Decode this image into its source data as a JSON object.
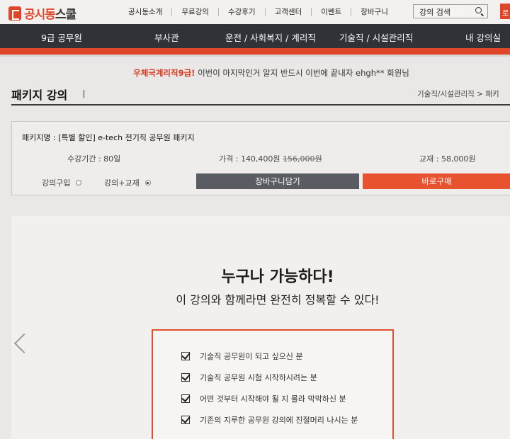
{
  "brand": {
    "name_accent": "공시동",
    "name_rest": "스쿨"
  },
  "top_nav": [
    "공시동소개",
    "무료강의",
    "수강후기",
    "고객센터",
    "이벤트",
    "장바구니"
  ],
  "search": {
    "placeholder": "강의 검색"
  },
  "top_cta": "로",
  "main_nav": [
    "9급 공무원",
    "부사관",
    "운전 / 사회복지 / 계리직",
    "기술직 / 시설관리직",
    "내 강의실"
  ],
  "notice": {
    "highlight": "우체국계리직9급!",
    "text": " 이번이 마지막인거 알지 반드시 이번에 끝내자 ehgh** 회원님"
  },
  "page": {
    "title": "패키지 강의",
    "breadcrumb": "기술직/시설관리직 > 패키"
  },
  "package": {
    "name": "패키지명 : [특별 할인] e-tech 전기직 공무원 패키지",
    "period": "수강기간 : 80일",
    "price_label": "가격 : 140,400원",
    "original_price": "156,000원",
    "textbook": "교재 : 58,000원",
    "option_course": "강의구입",
    "option_bundle": "강의+교재",
    "cart_button": "장바구니담기",
    "buy_button": "바로구매"
  },
  "promo": {
    "headline": "누구나 가능하다!",
    "subline": "이 강의와 함께라면 완전히 정복할 수 있다!",
    "checklist": [
      "기술직 공무원이 되고 싶으신 분",
      "기술직 공무원 시험 시작하시려는 분",
      "어떤 것부터 시작해야 될 지 몰라 막막하신 분",
      "기존의 지루한 공무원 강의에 진절머리 나시는 분"
    ]
  },
  "colors": {
    "accent": "#e0452a",
    "nav_dark": "#2f3236",
    "cart_gray": "#595c63"
  },
  "icons": [
    "search-icon",
    "radio-icon",
    "checkbox-checked-icon",
    "chevron-left-icon"
  ]
}
